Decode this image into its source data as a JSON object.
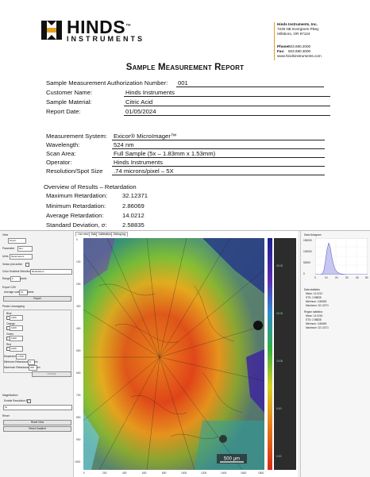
{
  "letterhead": {
    "logo_word": "HINDS",
    "logo_tm": "™",
    "logo_sub": "INSTRUMENTS",
    "company": "Hinds Instruments, Inc.",
    "street": "7245 NE Evergreen Pkwy",
    "city": "Hillsboro, OR 97124",
    "phone_label": "Phone:",
    "phone": "503.690.2000",
    "fax_label": "Fax:",
    "fax": "503.690.3000",
    "website": "www.hindsinstruments.com",
    "accent_color": "#e0a020"
  },
  "report": {
    "title": "Sample Measurement Report",
    "fields": [
      {
        "label": "Sample Measurement Authorization Number:",
        "value": "001"
      },
      {
        "label": "Customer Name:",
        "value": "Hinds Instruments"
      },
      {
        "label": "Sample Material:",
        "value": "Citric Acid"
      },
      {
        "label": "Report Date:",
        "value": "01/05/2024"
      }
    ],
    "system_fields": [
      {
        "label": "Measurement System:",
        "value": "Exicor® MicroImager™"
      },
      {
        "label": "Wavelength:",
        "value": "524 nm"
      },
      {
        "label": "Scan Area:",
        "value": "Full Sample (5x – 1.83mm x 1.53mm)"
      },
      {
        "label": "Operator:",
        "value": "Hinds Instruments"
      },
      {
        "label": "Resolution/Spot Size",
        "value": ".74 microns/pixel – 5X"
      }
    ],
    "overview_title": "Overview of Results – Retardation",
    "overview": [
      {
        "label": "Maximum Retardation:",
        "value": "32.12371"
      },
      {
        "label": "Minimum Retardation:",
        "value": "2.86069"
      },
      {
        "label": "Average Retardation:",
        "value": "14.0212"
      },
      {
        "label": "Standard Deviation, σ:",
        "value": "2.58835"
      }
    ]
  },
  "app": {
    "left": {
      "view_label": "View",
      "view_value": "Green",
      "param_label": "Parameter",
      "param_value": "Ret",
      "units_label": "Units",
      "units_value": "Nanometers",
      "vector_plot_label": "Vector plot active",
      "color_gradient_label": "Color Gradient Selection",
      "color_gradient_value": "Retardance",
      "range_label": "Range",
      "range_value": "0",
      "range_unit": "pixels",
      "export_header": "Export CSV",
      "average_label": "Average over",
      "average_value": "10",
      "average_unit": "pixels",
      "export_button": "Export",
      "phase_header": "Phase Unwrapping",
      "blue_label": "Blue",
      "blue_value": "1200",
      "orange_label": "Orange",
      "orange_value": "1200",
      "green_label": "Green",
      "green_value": "1200",
      "red_label": "Red",
      "red_value": "1200",
      "dispersion_label": "Dispersion",
      "dispersion_value": "1.000",
      "min_ret_label": "Minimum Retardance",
      "min_ret_value": "0",
      "min_ret_unit": "nm",
      "max_ret_label": "Maximum Retardance",
      "max_ret_value": "200",
      "max_ret_unit": "nm",
      "unwrap_button": "Unwrap",
      "magnification_header": "Magnification",
      "resolution_bar_label": "Enable Resolution Bar",
      "magnification_value": "5x",
      "reset_header": "Reset",
      "reset_view_button": "Reset View",
      "reset_gradient_button": "Reset Gradient"
    },
    "tabs": [
      "Live view",
      "Data",
      "Calibration",
      "Debug log"
    ],
    "scale_bar": "500 µm",
    "x_ticks": [
      "0",
      "200",
      "400",
      "600",
      "800",
      "1000",
      "1200",
      "1400",
      "1600",
      "1800"
    ],
    "y_ticks": [
      "0",
      "100",
      "200",
      "300",
      "400",
      "500",
      "600",
      "700",
      "800",
      "900",
      "1000"
    ],
    "colorbar_ticks": [
      "30.00",
      "20.00",
      "10.00",
      "5.00",
      "0.00"
    ],
    "right": {
      "histogram_title": "Data histogram",
      "hist_y_ticks": [
        "150000",
        "100000",
        "50000",
        "0"
      ],
      "hist_x_ticks": [
        "0",
        "10",
        "20",
        "30",
        "40",
        "50"
      ],
      "data_stats_title": "Data statistics",
      "data_stats": [
        "Mean: 14.0212",
        "STD: 2.58835",
        "Minimum: 2.86069",
        "Maximum: 32.12371"
      ],
      "region_stats_title": "Region statistics",
      "region_stats": [
        "Mean: 14.0216",
        "STD: 2.58838",
        "Minimum: 2.86069",
        "Maximum: 32.12371"
      ]
    }
  }
}
